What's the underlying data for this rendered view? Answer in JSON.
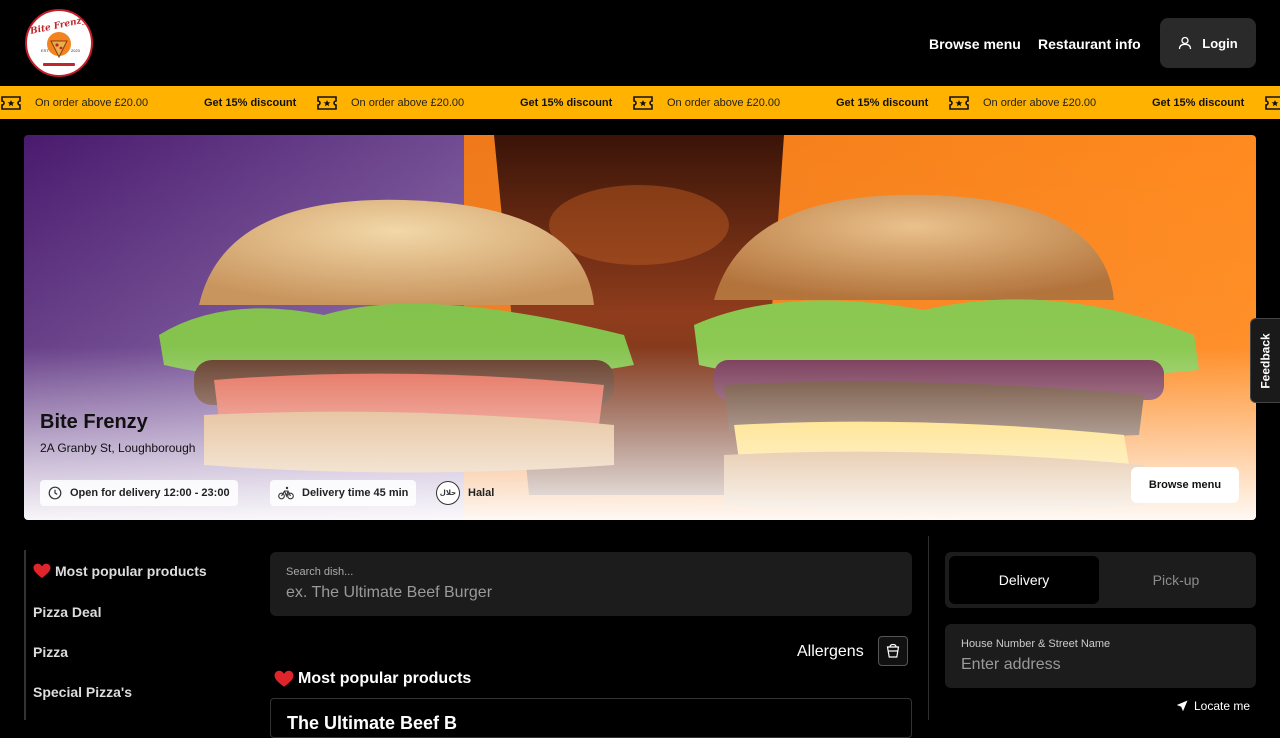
{
  "header": {
    "logo_text": "Bite Frenzy",
    "nav": {
      "browse_menu": "Browse menu",
      "restaurant_info": "Restaurant info"
    },
    "login_label": "Login"
  },
  "ticker": {
    "order_text": "On order above £20.00",
    "discount_text": "Get 15% discount",
    "color": "#ffb300"
  },
  "hero": {
    "name": "Bite Frenzy",
    "address": "2A Granby St, Loughborough",
    "open_text": "Open for delivery 12:00 - 23:00",
    "delivery_time": "Delivery time 45 min",
    "halal": "Halal",
    "browse_button": "Browse menu"
  },
  "feedback": "Feedback",
  "categories": [
    {
      "label": "Most popular products",
      "icon": "heart-icon"
    },
    {
      "label": "Pizza Deal"
    },
    {
      "label": "Pizza"
    },
    {
      "label": "Special Pizza's"
    }
  ],
  "search": {
    "label": "Search dish...",
    "placeholder": "ex. The Ultimate Beef Burger"
  },
  "allergens_label": "Allergens",
  "section": {
    "title": "Most popular products",
    "first_product": "The Ultimate Beef B"
  },
  "order_panel": {
    "delivery": "Delivery",
    "pickup": "Pick-up",
    "address_label": "House Number & Street Name",
    "address_placeholder": "Enter address",
    "locate": "Locate me"
  }
}
